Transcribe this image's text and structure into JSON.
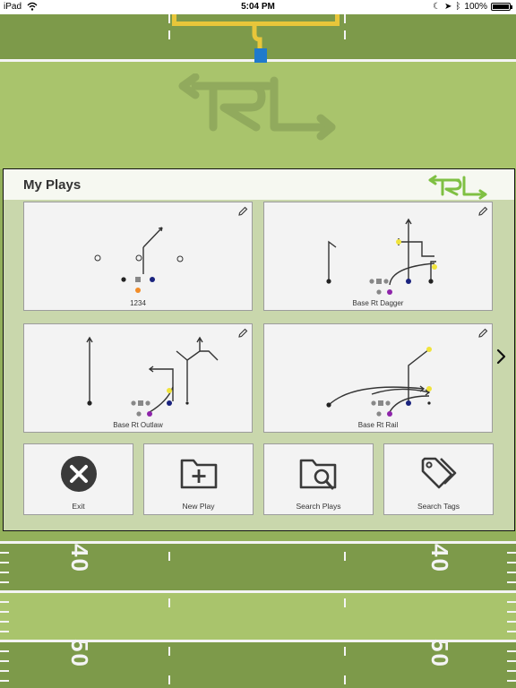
{
  "status_bar": {
    "carrier": "iPad",
    "time": "5:04 PM",
    "battery": "100%",
    "battery_level": 1.0
  },
  "panel": {
    "title": "My Plays",
    "logo_icon": "rl-logo-icon"
  },
  "plays": [
    {
      "label": "1234",
      "edit_icon": "pencil-icon"
    },
    {
      "label": "Base Rt Dagger",
      "edit_icon": "pencil-icon"
    },
    {
      "label": "Base Rt Outlaw",
      "edit_icon": "pencil-icon"
    },
    {
      "label": "Base Rt Rail",
      "edit_icon": "pencil-icon"
    }
  ],
  "actions": [
    {
      "label": "Exit",
      "icon": "close-circle-icon"
    },
    {
      "label": "New Play",
      "icon": "folder-plus-icon"
    },
    {
      "label": "Search Plays",
      "icon": "folder-search-icon"
    },
    {
      "label": "Search Tags",
      "icon": "tags-icon"
    }
  ],
  "field": {
    "yard_numbers": [
      "40",
      "40",
      "50",
      "50"
    ],
    "logo_icon": "rl-logo-icon"
  },
  "navigation": {
    "next_icon": "chevron-right-icon"
  },
  "colors": {
    "field_dark": "#7d9a4a",
    "field_light": "#a9c46c",
    "goalpost": "#e8c63a",
    "logo": "#7fc043"
  }
}
